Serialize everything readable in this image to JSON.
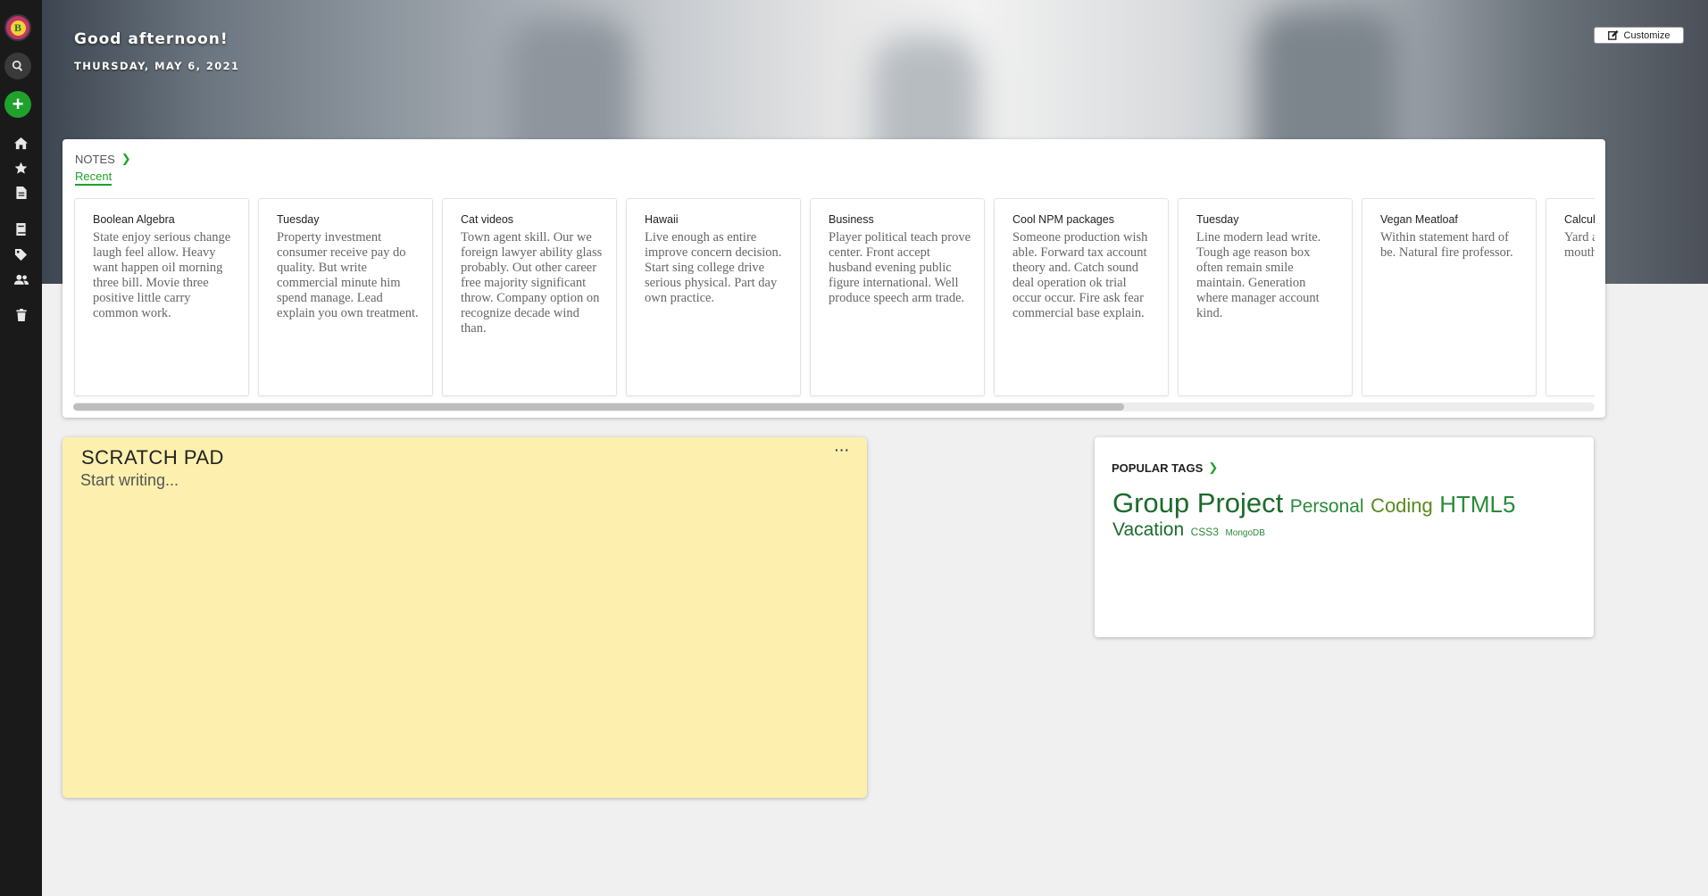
{
  "sidebar": {
    "avatar_letter": "B",
    "icons": [
      "search-icon",
      "add-icon",
      "home-icon",
      "star-icon",
      "note-icon",
      "notebook-icon",
      "tag-icon",
      "people-icon",
      "trash-icon"
    ]
  },
  "hero": {
    "greeting": "Good afternoon!",
    "date": "THURSDAY, MAY 6, 2021",
    "customize_label": "Customize"
  },
  "notes": {
    "title": "NOTES",
    "tab_recent": "Recent",
    "cards": [
      {
        "title": "Boolean Algebra",
        "body": "State enjoy serious change laugh feel allow. Heavy want happen oil morning three bill. Movie three positive little carry common work."
      },
      {
        "title": "Tuesday",
        "body": "Property investment consumer receive pay do quality. But write commercial minute him spend manage. Lead explain you own treatment."
      },
      {
        "title": "Cat videos",
        "body": "Town agent skill. Our we foreign lawyer ability glass probably. Out other career free majority significant throw. Company option on recognize decade wind than."
      },
      {
        "title": "Hawaii",
        "body": "Live enough as entire improve concern decision. Start sing college drive serious physical. Part day own practice."
      },
      {
        "title": "Business",
        "body": "Player political teach prove center. Front accept husband evening public figure international. Well produce speech arm trade."
      },
      {
        "title": "Cool NPM packages",
        "body": "Someone production wish able. Forward tax account theory and. Catch sound deal operation ok trial occur occur. Fire ask fear commercial base explain."
      },
      {
        "title": "Tuesday",
        "body": "Line modern lead write. Tough age reason box often remain smile maintain. Generation where manager account kind."
      },
      {
        "title": "Vegan Meatloaf",
        "body": "Within statement hard of be. Natural fire professor."
      },
      {
        "title": "Calculu",
        "body": "Yard a mainta free sk mouth execut"
      }
    ]
  },
  "scratch": {
    "title": "SCRATCH PAD",
    "more": "···",
    "placeholder": "Start writing..."
  },
  "tags": {
    "title": "POPULAR TAGS",
    "items": [
      {
        "label": "Group Project",
        "color": "#1b6b2c"
      },
      {
        "label": "Personal",
        "color": "#2b8a3a"
      },
      {
        "label": "Coding",
        "color": "#5a8a1e"
      },
      {
        "label": "HTML5",
        "color": "#2b8a3a"
      },
      {
        "label": "Vacation",
        "color": "#1b6b2c"
      },
      {
        "label": "CSS3",
        "color": "#2b8a3a"
      },
      {
        "label": "MongoDB",
        "color": "#2b8a3a"
      }
    ]
  }
}
